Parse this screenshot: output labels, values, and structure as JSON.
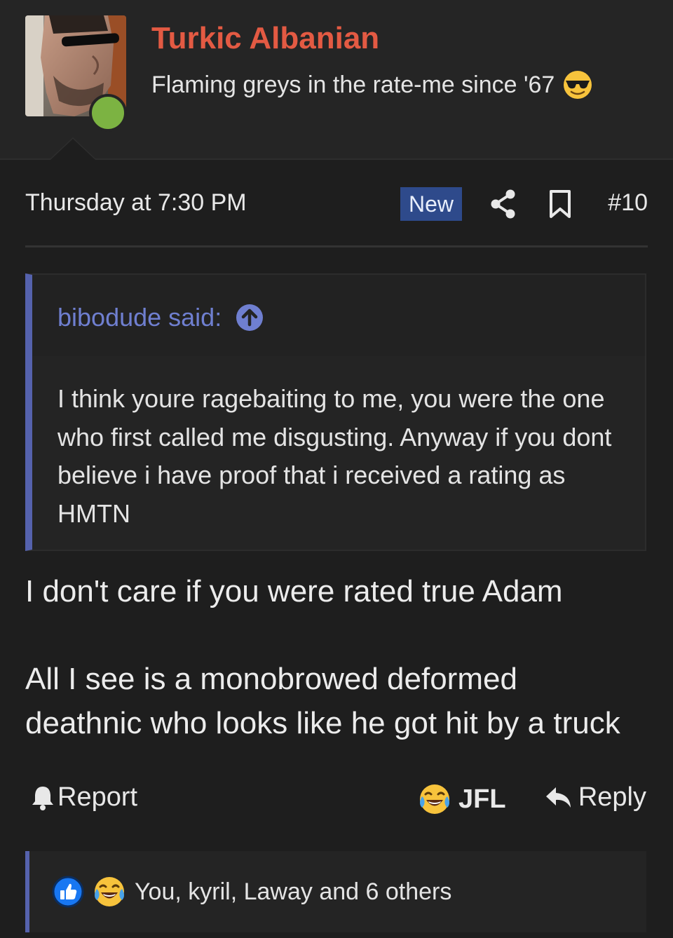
{
  "user": {
    "name": "Turkic Albanian",
    "title": "Flaming greys in the rate-me since '67",
    "title_emoji": "sunglasses-emoji",
    "online": true
  },
  "post": {
    "date": "Thursday at 7:30 PM",
    "new_badge": "New",
    "number": "#10"
  },
  "quote": {
    "author": "bibodude said:",
    "text": "I think youre ragebaiting to me, you were the one who first called me disgusting. Anyway if you dont believe i have proof that i received a rating as HMTN"
  },
  "body": {
    "paragraph_1": "I don't care if you were rated true Adam",
    "paragraph_2_line_1": "All I see is a monobrowed deformed",
    "paragraph_2_line_2": "deathnic who looks like he got hit by a truck"
  },
  "actions": {
    "report_label": "Report",
    "jfl_label": "JFL",
    "reply_label": "Reply"
  },
  "reactions": {
    "icons": [
      "like-icon",
      "laughing-crying-emoji"
    ],
    "summary": "You, kyril, Laway and 6 others"
  },
  "colors": {
    "background": "#1e1e1e",
    "username": "#e35a43",
    "accent": "#5562ad",
    "quote_author": "#6f7fd0",
    "online": "#7cb342",
    "new_badge": "#2e4a8b"
  }
}
